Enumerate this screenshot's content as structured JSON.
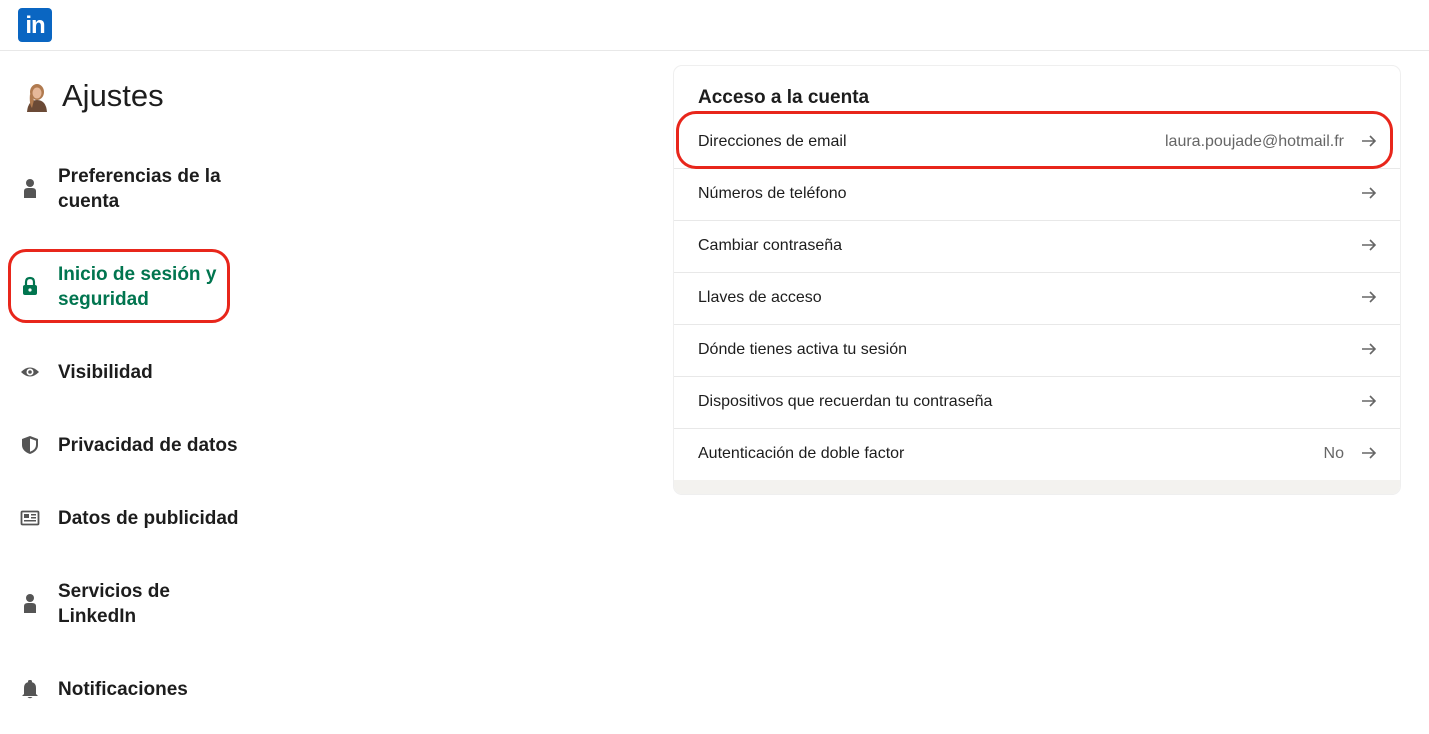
{
  "colors": {
    "brand": "#0a66c2",
    "active": "#01754f",
    "highlight": "#e8261b"
  },
  "header": {
    "logo_text": "in",
    "logo_icon": "linkedin-logo-icon"
  },
  "sidebar": {
    "title": "Ajustes",
    "items": [
      {
        "label": "Preferencias de la cuenta",
        "icon": "person-icon",
        "active": false
      },
      {
        "label": "Inicio de sesión y seguridad",
        "icon": "lock-icon",
        "active": true
      },
      {
        "label": "Visibilidad",
        "icon": "eye-icon",
        "active": false
      },
      {
        "label": "Privacidad de datos",
        "icon": "shield-icon",
        "active": false
      },
      {
        "label": "Datos de publicidad",
        "icon": "newspaper-icon",
        "active": false
      },
      {
        "label": "Servicios de LinkedIn",
        "icon": "person-icon",
        "active": false
      },
      {
        "label": "Notificaciones",
        "icon": "bell-icon",
        "active": false
      }
    ]
  },
  "main": {
    "section_title": "Acceso a la cuenta",
    "rows": [
      {
        "label": "Direcciones de email",
        "value": "laura.poujade@hotmail.fr"
      },
      {
        "label": "Números de teléfono",
        "value": ""
      },
      {
        "label": "Cambiar contraseña",
        "value": ""
      },
      {
        "label": "Llaves de acceso",
        "value": ""
      },
      {
        "label": "Dónde tienes activa tu sesión",
        "value": ""
      },
      {
        "label": "Dispositivos que recuerdan tu contraseña",
        "value": ""
      },
      {
        "label": "Autenticación de doble factor",
        "value": "No"
      }
    ]
  }
}
